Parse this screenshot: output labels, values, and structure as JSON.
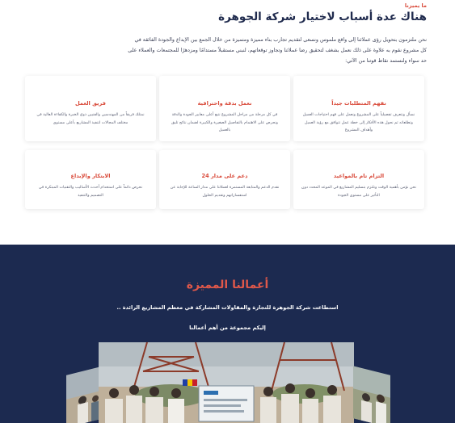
{
  "why": {
    "eyebrow": "ما يميزنا",
    "heading": "هناك عدة أسباب لاختيار شركة الجوهرة",
    "intro": "نحن ملتزمون بتحويل رؤى عملائنا إلى واقع ملموس ونسعى لتقديم تجارب بناء مميزة ومتميزة من خلال الجمع بين الإبداع والجودة الفائقة في كل مشروع نقوم به علاوة على ذلك نعمل بشغف لتحقيق رضا عملائنا وتجاوز توقعاتهم، لنبني مستقبلاً مستدامًا ومزدهرًا للمجتمعات والعملاء على حد سواء ولنستمد نقاط قوتنا من الآتي:",
    "cards": [
      {
        "title": "نفهم المتطلبات جيداً",
        "desc": "نسأل ونتعرف تفصيلياً على المشروع ونعمل على فهم احتياجات العميل وتطلعاته ثم نحول هذه الأفكار إلى خطة عمل تتوافق مع رؤية العميل وأهداف المشروع"
      },
      {
        "title": "نعمل بدقة واحترافية",
        "desc": "في كل مرحلة من مراحل المشروع نتبع أعلى معايير الجودة والدقة ونحرص على الاهتمام بالتفاصيل الصغيرة والكبيرة لضمان نتائج تليق بالعميل"
      },
      {
        "title": "فريق العمل",
        "desc": "نمتلك فريقاً من المهندسين والفنيين ذوي الخبرة والكفاءة العالية في مختلف المجالات لتنفيذ المشاريع بأعلى مستوى"
      },
      {
        "title": "التزام تام بالمواعيد",
        "desc": "نحن نؤمن بأهمية الوقت ونلتزم بتسليم المشاريع في الموعد المحدد دون التأثير على مستوى الجودة"
      },
      {
        "title": "دعم على مدار 24",
        "desc": "نقدم الدعم والمتابعة المستمرة لعملائنا على مدار الساعة للإجابة عن استفساراتهم وتقديم الحلول"
      },
      {
        "title": "الابتكار والإبداع",
        "desc": "نحرص دائماً على استخدام أحدث الأساليب والتقنيات المبتكرة في التصميم والتنفيذ"
      }
    ]
  },
  "works": {
    "title": "أعمالنا المميزة",
    "subtitle": "استطاعت شركة الجوهرة للتجارة والمقاولات المشاركة في معظم المشاريع الرائدة ..",
    "subtitle2": "إليكم مجموعة من أهم أعمالنا"
  },
  "colors": {
    "accent": "#d94a3a",
    "navy": "#1c2a50",
    "heading": "#1f2a4d"
  }
}
